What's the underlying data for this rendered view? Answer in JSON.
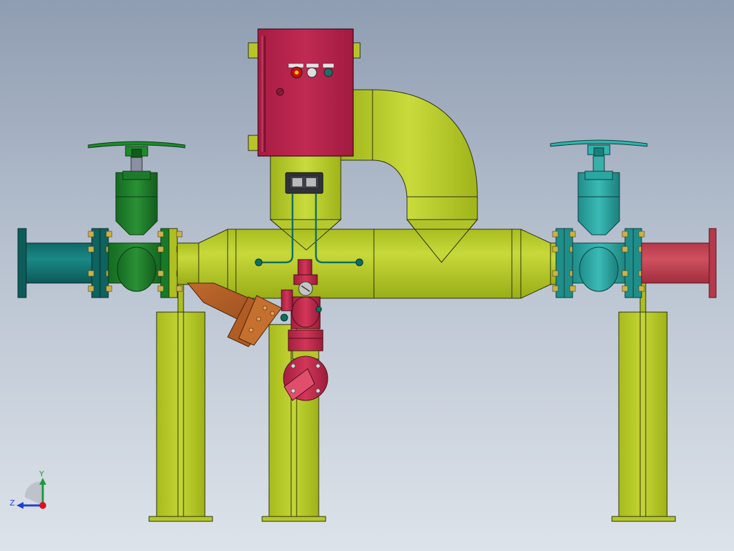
{
  "viewport": {
    "background_top": "#8f9db2",
    "background_bottom": "#dde3ea"
  },
  "triad": {
    "y_label": "Y",
    "z_label": "Z",
    "y_color": "#1a9b3a",
    "z_color": "#1f3fd6",
    "x_color": "#d8131b"
  },
  "colors": {
    "meter_body": "#bcd12a",
    "meter_shadow": "#8ea118",
    "control_box": "#b8204a",
    "valve_left": "#1c7a2a",
    "valve_right": "#2aa7a3",
    "inlet_pipe": "#137a78",
    "outlet_pipe": "#c94354",
    "strainer": "#b5612a",
    "relief_valve": "#c22a49",
    "support_legs": "#bcd12a"
  },
  "components": [
    {
      "name": "control-box",
      "icon": "electrical-enclosure"
    },
    {
      "name": "flow-meter-body",
      "icon": "coriolis-meter"
    },
    {
      "name": "left-gate-valve",
      "icon": "handwheel-valve"
    },
    {
      "name": "right-gate-valve",
      "icon": "handwheel-valve"
    },
    {
      "name": "inlet-pipe",
      "icon": "flanged-pipe"
    },
    {
      "name": "outlet-pipe",
      "icon": "flanged-pipe"
    },
    {
      "name": "y-strainer",
      "icon": "y-strainer"
    },
    {
      "name": "relief-valve",
      "icon": "relief-valve"
    },
    {
      "name": "transmitter",
      "icon": "transmitter-head"
    }
  ]
}
